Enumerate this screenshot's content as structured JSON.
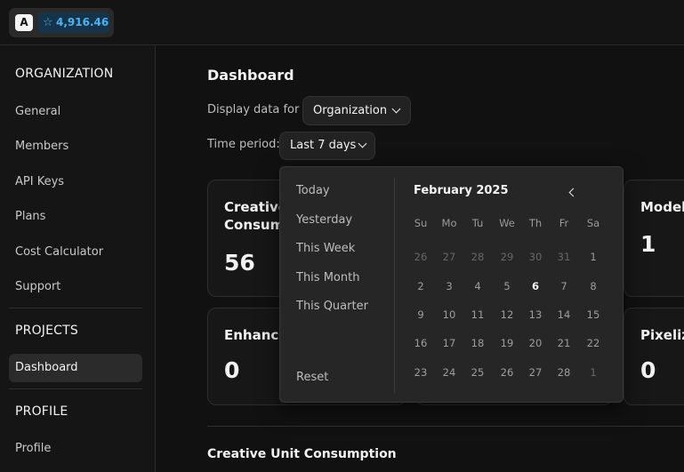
{
  "header": {
    "logo_letter": "A",
    "credits": "4,916.46",
    "credits_icon": "star-icon"
  },
  "sidebar": {
    "sections": [
      {
        "title": "ORGANIZATION",
        "items": [
          "General",
          "Members",
          "API Keys",
          "Plans",
          "Cost Calculator",
          "Support"
        ]
      },
      {
        "title": "PROJECTS",
        "items": [
          "Dashboard"
        ]
      },
      {
        "title": "PROFILE",
        "items": [
          "Profile"
        ]
      }
    ],
    "active_item": "Dashboard"
  },
  "main": {
    "title": "Dashboard",
    "display_label": "Display data for",
    "display_value": "Organization",
    "period_label": "Time period:",
    "period_value": "Last 7 days",
    "cards": [
      {
        "title_line1": "Creative",
        "title_line2": "Consum",
        "value": "56"
      },
      {
        "title_line1": "Models",
        "value": "1"
      },
      {
        "title_line1": "Enhance",
        "value": "0"
      },
      {
        "title_line1": "Pixeliza",
        "value": "0"
      }
    ],
    "section_title": "Creative Unit Consumption"
  },
  "popover": {
    "presets": [
      "Today",
      "Yesterday",
      "This Week",
      "This Month",
      "This Quarter"
    ],
    "reset": "Reset",
    "month": "February 2025",
    "weekdays": [
      "Su",
      "Mo",
      "Tu",
      "We",
      "Th",
      "Fr",
      "Sa"
    ],
    "weeks": [
      [
        "26",
        "27",
        "28",
        "29",
        "30",
        "31",
        "1"
      ],
      [
        "2",
        "3",
        "4",
        "5",
        "6",
        "7",
        "8"
      ],
      [
        "9",
        "10",
        "11",
        "12",
        "13",
        "14",
        "15"
      ],
      [
        "16",
        "17",
        "18",
        "19",
        "20",
        "21",
        "22"
      ],
      [
        "23",
        "24",
        "25",
        "26",
        "27",
        "28",
        "1"
      ]
    ]
  },
  "colors": {
    "accent": "#4db3f0",
    "background": "#111111",
    "panel": "#262626"
  }
}
